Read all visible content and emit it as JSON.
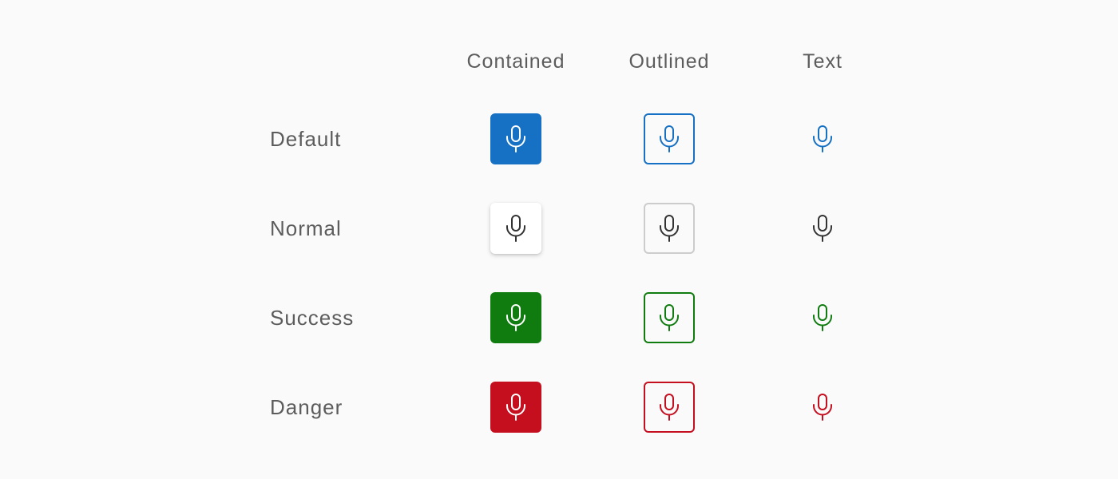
{
  "columns": [
    "Contained",
    "Outlined",
    "Text"
  ],
  "rows": [
    {
      "label": "Default",
      "variant": "default",
      "color": "#1670c4",
      "icon": "microphone-icon"
    },
    {
      "label": "Normal",
      "variant": "normal",
      "color": "#333333",
      "outline_border": "#cccccc",
      "icon": "microphone-icon"
    },
    {
      "label": "Success",
      "variant": "success",
      "color": "#107c10",
      "icon": "microphone-icon"
    },
    {
      "label": "Danger",
      "variant": "danger",
      "color": "#c50f1f",
      "icon": "microphone-icon"
    }
  ]
}
